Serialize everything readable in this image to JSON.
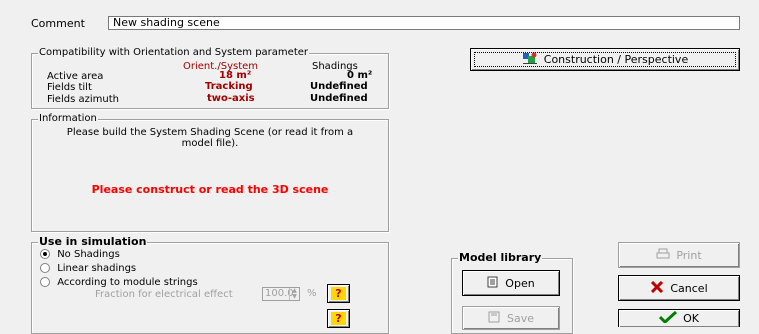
{
  "comment": {
    "label": "Comment",
    "value": "New shading scene"
  },
  "compat": {
    "legend": "Compatibility with Orientation and System parameter",
    "col_orient": "Orient./System",
    "col_shadings": "Shadings",
    "rows": [
      {
        "label": "Active area",
        "orient": "18 m²",
        "shadings": "0 m²"
      },
      {
        "label": "Fields tilt",
        "orient": "Tracking",
        "shadings": "Undefined"
      },
      {
        "label": "Fields azimuth",
        "orient": "two-axis",
        "shadings": "Undefined"
      }
    ]
  },
  "construction_button": {
    "label": "Construction / Perspective",
    "icon": "construction-icon"
  },
  "info": {
    "legend": "Information",
    "message": "Please build the System Shading Scene  (or read it from a model file).",
    "warning": "Please construct or read the 3D scene",
    "warning_color": "#ff0000"
  },
  "simulation": {
    "legend": "Use in simulation",
    "options": [
      {
        "label": "No Shadings",
        "checked": true
      },
      {
        "label": "Linear shadings",
        "checked": false
      },
      {
        "label": "According to module strings",
        "checked": false
      }
    ],
    "fraction_label": "Fraction for electrical effect",
    "fraction_value": "100.0",
    "fraction_unit": "%",
    "help_label": "?"
  },
  "model_library": {
    "legend": "Model library",
    "open_label": "Open",
    "save_label": "Save"
  },
  "buttons": {
    "print_label": "Print",
    "cancel_label": "Cancel",
    "ok_label": "OK"
  },
  "colors": {
    "accent_red": "#a40000",
    "background": "#f0f0f0"
  }
}
